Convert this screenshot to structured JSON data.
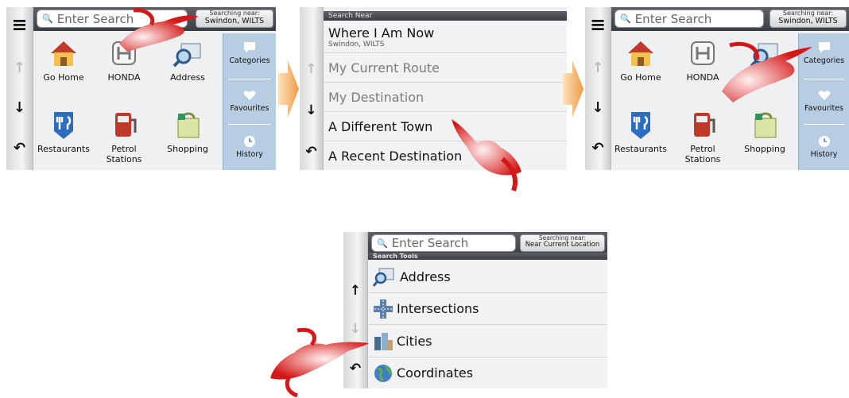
{
  "screens": {
    "s1": {
      "search_placeholder": "Enter Search",
      "near_label": "Searching near:",
      "near_value": "Swindon, WILTS",
      "tiles": [
        {
          "label": "Go Home",
          "icon": "home-icon"
        },
        {
          "label": "HONDA",
          "icon": "honda-logo-icon"
        },
        {
          "label": "Address",
          "icon": "address-icon"
        },
        {
          "label": "Restaurants",
          "icon": "restaurant-icon"
        },
        {
          "label": "Petrol Stations",
          "icon": "petrol-pump-icon"
        },
        {
          "label": "Shopping",
          "icon": "shopping-bag-icon"
        }
      ],
      "side": [
        {
          "label": "Categories",
          "icon": "speech-bubble-icon"
        },
        {
          "label": "Favourites",
          "icon": "heart-icon"
        },
        {
          "label": "History",
          "icon": "clock-icon"
        }
      ]
    },
    "s2": {
      "header": "Search Near",
      "rows": [
        {
          "title": "Where I Am Now",
          "subtitle": "Swindon, WILTS"
        },
        {
          "title": "My Current Route"
        },
        {
          "title": "My Destination"
        },
        {
          "title": "A Different Town"
        },
        {
          "title": "A Recent Destination"
        }
      ]
    },
    "s3": {
      "search_placeholder": "Enter Search",
      "near_label": "Searching near:",
      "near_value": "Swindon, WILTS",
      "tiles": [
        {
          "label": "Go Home",
          "icon": "home-icon"
        },
        {
          "label": "HONDA",
          "icon": "honda-logo-icon"
        },
        {
          "label": "Address",
          "icon": "address-icon"
        },
        {
          "label": "Restaurants",
          "icon": "restaurant-icon"
        },
        {
          "label": "Petrol Stations",
          "icon": "petrol-pump-icon"
        },
        {
          "label": "Shopping",
          "icon": "shopping-bag-icon"
        }
      ],
      "side": [
        {
          "label": "Categories",
          "icon": "speech-bubble-icon"
        },
        {
          "label": "Favourites",
          "icon": "heart-icon"
        },
        {
          "label": "History",
          "icon": "clock-icon"
        }
      ]
    },
    "s4": {
      "search_placeholder": "Enter Search",
      "near_label": "Searching near:",
      "near_value": "Near Current Location",
      "header": "Search Tools",
      "rows": [
        {
          "label": "Address",
          "icon": "address-icon"
        },
        {
          "label": "Intersections",
          "icon": "intersection-icon"
        },
        {
          "label": "Cities",
          "icon": "city-icon"
        },
        {
          "label": "Coordinates",
          "icon": "globe-icon"
        }
      ]
    }
  },
  "glyphs": {
    "menu": "≡",
    "up": "↑",
    "down": "↓",
    "back": "↶",
    "search": "🔍"
  },
  "colors": {
    "accent_side": "#b7cde2",
    "flow_arrow": "#f0a04a",
    "hand": "#d41818"
  }
}
